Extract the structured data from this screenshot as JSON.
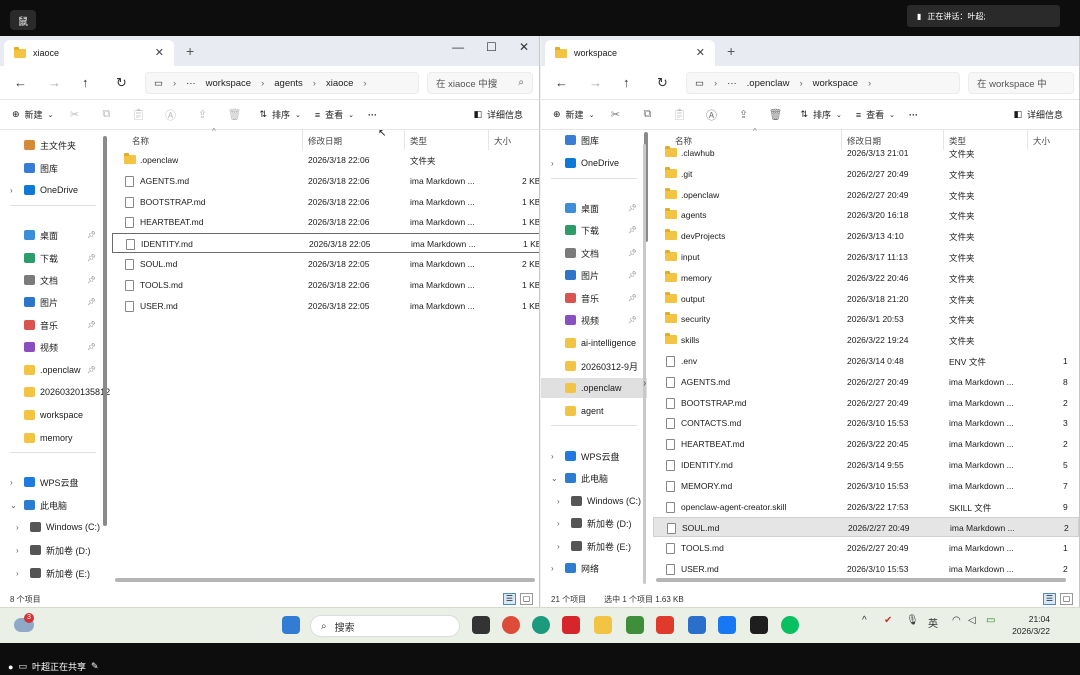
{
  "share_badge": "鼠",
  "left": {
    "tab_title": "xiaoce",
    "breadcrumb": [
      "workspace",
      "agents",
      "xiaoce"
    ],
    "search_placeholder": "在 xiaoce 中搜",
    "toolbar": {
      "new": "新建",
      "sort": "排序",
      "view": "查看",
      "more": "···",
      "details": "详细信息"
    },
    "sidebar": [
      {
        "label": "主文件夹",
        "icon": "home-icon"
      },
      {
        "label": "图库",
        "icon": "gallery-icon"
      },
      {
        "label": "OneDrive",
        "icon": "cloud-icon"
      },
      {
        "label": "桌面",
        "icon": "desktop-icon"
      },
      {
        "label": "下载",
        "icon": "download-icon"
      },
      {
        "label": "文档",
        "icon": "document-icon"
      },
      {
        "label": "图片",
        "icon": "picture-icon"
      },
      {
        "label": "音乐",
        "icon": "music-icon"
      },
      {
        "label": "视频",
        "icon": "video-icon"
      },
      {
        "label": ".openclaw",
        "icon": "folder-icon"
      },
      {
        "label": "20260320135812",
        "icon": "folder-icon"
      },
      {
        "label": "workspace",
        "icon": "folder-icon"
      },
      {
        "label": "memory",
        "icon": "folder-icon"
      },
      {
        "label": "WPS云盘",
        "icon": "wps-cloud-icon"
      },
      {
        "label": "此电脑",
        "icon": "pc-icon"
      },
      {
        "label": "Windows (C:)",
        "icon": "drive-icon"
      },
      {
        "label": "新加卷 (D:)",
        "icon": "drive-icon"
      },
      {
        "label": "新加卷 (E:)",
        "icon": "drive-icon"
      }
    ],
    "columns": {
      "name": "名称",
      "date": "修改日期",
      "type": "类型",
      "size": "大小"
    },
    "files": [
      {
        "name": ".openclaw",
        "date": "2026/3/18 22:06",
        "type": "文件夹",
        "size": "",
        "folder": true
      },
      {
        "name": "AGENTS.md",
        "date": "2026/3/18 22:06",
        "type": "ima Markdown ...",
        "size": "2 KB",
        "folder": false
      },
      {
        "name": "BOOTSTRAP.md",
        "date": "2026/3/18 22:06",
        "type": "ima Markdown ...",
        "size": "1 KB",
        "folder": false
      },
      {
        "name": "HEARTBEAT.md",
        "date": "2026/3/18 22:06",
        "type": "ima Markdown ...",
        "size": "1 KB",
        "folder": false
      },
      {
        "name": "IDENTITY.md",
        "date": "2026/3/18 22:05",
        "type": "ima Markdown ...",
        "size": "1 KB",
        "folder": false
      },
      {
        "name": "SOUL.md",
        "date": "2026/3/18 22:05",
        "type": "ima Markdown ...",
        "size": "2 KB",
        "folder": false
      },
      {
        "name": "TOOLS.md",
        "date": "2026/3/18 22:06",
        "type": "ima Markdown ...",
        "size": "1 KB",
        "folder": false
      },
      {
        "name": "USER.md",
        "date": "2026/3/18 22:05",
        "type": "ima Markdown ...",
        "size": "1 KB",
        "folder": false
      }
    ],
    "status": "8 个项目"
  },
  "right": {
    "tab_title": "workspace",
    "breadcrumb": [
      ".openclaw",
      "workspace"
    ],
    "search_placeholder": "在 workspace 中",
    "toolbar": {
      "new": "新建",
      "sort": "排序",
      "view": "查看",
      "more": "···",
      "details": "详细信息"
    },
    "sidebar": [
      {
        "label": "图库",
        "icon": "gallery-icon"
      },
      {
        "label": "OneDrive",
        "icon": "cloud-icon"
      },
      {
        "label": "桌面",
        "icon": "desktop-icon"
      },
      {
        "label": "下载",
        "icon": "download-icon"
      },
      {
        "label": "文档",
        "icon": "document-icon"
      },
      {
        "label": "图片",
        "icon": "picture-icon"
      },
      {
        "label": "音乐",
        "icon": "music-icon"
      },
      {
        "label": "视频",
        "icon": "video-icon"
      },
      {
        "label": "ai-intelligence",
        "icon": "folder-icon"
      },
      {
        "label": "20260312-9月",
        "icon": "folder-icon"
      },
      {
        "label": ".openclaw",
        "icon": "folder-icon"
      },
      {
        "label": "agent",
        "icon": "folder-icon"
      },
      {
        "label": "WPS云盘",
        "icon": "wps-cloud-icon"
      },
      {
        "label": "此电脑",
        "icon": "pc-icon"
      },
      {
        "label": "Windows (C:)",
        "icon": "drive-icon"
      },
      {
        "label": "新加卷 (D:)",
        "icon": "drive-icon"
      },
      {
        "label": "新加卷 (E:)",
        "icon": "drive-icon"
      },
      {
        "label": "网络",
        "icon": "network-icon"
      }
    ],
    "columns": {
      "name": "名称",
      "date": "修改日期",
      "type": "类型",
      "size": "大小"
    },
    "files": [
      {
        "name": ".clawhub",
        "date": "2026/3/13 21:01",
        "type": "文件夹",
        "size": "",
        "folder": true
      },
      {
        "name": ".git",
        "date": "2026/2/27 20:49",
        "type": "文件夹",
        "size": "",
        "folder": true
      },
      {
        "name": ".openclaw",
        "date": "2026/2/27 20:49",
        "type": "文件夹",
        "size": "",
        "folder": true
      },
      {
        "name": "agents",
        "date": "2026/3/20 16:18",
        "type": "文件夹",
        "size": "",
        "folder": true
      },
      {
        "name": "devProjects",
        "date": "2026/3/13 4:10",
        "type": "文件夹",
        "size": "",
        "folder": true
      },
      {
        "name": "input",
        "date": "2026/3/17 11:13",
        "type": "文件夹",
        "size": "",
        "folder": true
      },
      {
        "name": "memory",
        "date": "2026/3/22 20:46",
        "type": "文件夹",
        "size": "",
        "folder": true
      },
      {
        "name": "output",
        "date": "2026/3/18 21:20",
        "type": "文件夹",
        "size": "",
        "folder": true
      },
      {
        "name": "security",
        "date": "2026/3/1 20:53",
        "type": "文件夹",
        "size": "",
        "folder": true
      },
      {
        "name": "skills",
        "date": "2026/3/22 19:24",
        "type": "文件夹",
        "size": "",
        "folder": true
      },
      {
        "name": ".env",
        "date": "2026/3/14 0:48",
        "type": "ENV 文件",
        "size": "1",
        "folder": false
      },
      {
        "name": "AGENTS.md",
        "date": "2026/2/27 20:49",
        "type": "ima Markdown ...",
        "size": "8",
        "folder": false
      },
      {
        "name": "BOOTSTRAP.md",
        "date": "2026/2/27 20:49",
        "type": "ima Markdown ...",
        "size": "2",
        "folder": false
      },
      {
        "name": "CONTACTS.md",
        "date": "2026/3/10 15:53",
        "type": "ima Markdown ...",
        "size": "3",
        "folder": false
      },
      {
        "name": "HEARTBEAT.md",
        "date": "2026/3/22 20:45",
        "type": "ima Markdown ...",
        "size": "2",
        "folder": false
      },
      {
        "name": "IDENTITY.md",
        "date": "2026/3/14 9:55",
        "type": "ima Markdown ...",
        "size": "5",
        "folder": false
      },
      {
        "name": "MEMORY.md",
        "date": "2026/3/10 15:53",
        "type": "ima Markdown ...",
        "size": "7",
        "folder": false
      },
      {
        "name": "openclaw-agent-creator.skill",
        "date": "2026/3/22 17:53",
        "type": "SKILL 文件",
        "size": "9",
        "folder": false
      },
      {
        "name": "SOUL.md",
        "date": "2026/2/27 20:49",
        "type": "ima Markdown ...",
        "size": "2",
        "folder": false
      },
      {
        "name": "TOOLS.md",
        "date": "2026/2/27 20:49",
        "type": "ima Markdown ...",
        "size": "1",
        "folder": false
      },
      {
        "name": "USER.md",
        "date": "2026/3/10 15:53",
        "type": "ima Markdown ...",
        "size": "2",
        "folder": false
      }
    ],
    "status_count": "21 个项目",
    "status_selected": "选中 1 个项目  1.63 KB"
  },
  "speaking": "正在讲话：叶超;",
  "taskbar": {
    "search": "搜索",
    "ime": "英",
    "time": "21:04",
    "date": "2026/3/22",
    "notif_count": "3"
  },
  "bottom": {
    "sharing": "叶超正在共享"
  }
}
